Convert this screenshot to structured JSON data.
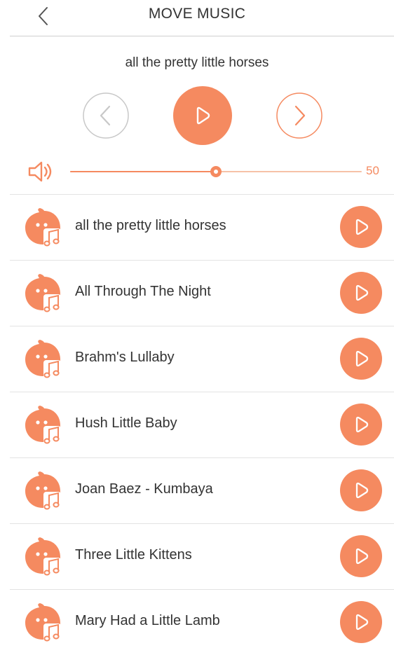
{
  "header": {
    "title": "MOVE MUSIC",
    "back_icon": "chevron-left-icon"
  },
  "player": {
    "now_playing": "all the pretty little horses",
    "prev_icon": "chevron-left-icon",
    "play_icon": "play-icon",
    "next_icon": "chevron-right-icon"
  },
  "volume": {
    "icon": "speaker-icon",
    "value": "50",
    "level_percent": 50
  },
  "songs": [
    {
      "title": "all the pretty little horses"
    },
    {
      "title": "All Through The Night"
    },
    {
      "title": "Brahm's Lullaby"
    },
    {
      "title": "Hush Little Baby"
    },
    {
      "title": "Joan Baez - Kumbaya"
    },
    {
      "title": "Three Little Kittens"
    },
    {
      "title": "Mary Had a Little Lamb"
    }
  ],
  "colors": {
    "accent": "#f58a60",
    "accent_light": "#f6c2a8",
    "text": "#333333",
    "divider": "#e3e3e3",
    "inactive_control": "#c8c8c8"
  }
}
